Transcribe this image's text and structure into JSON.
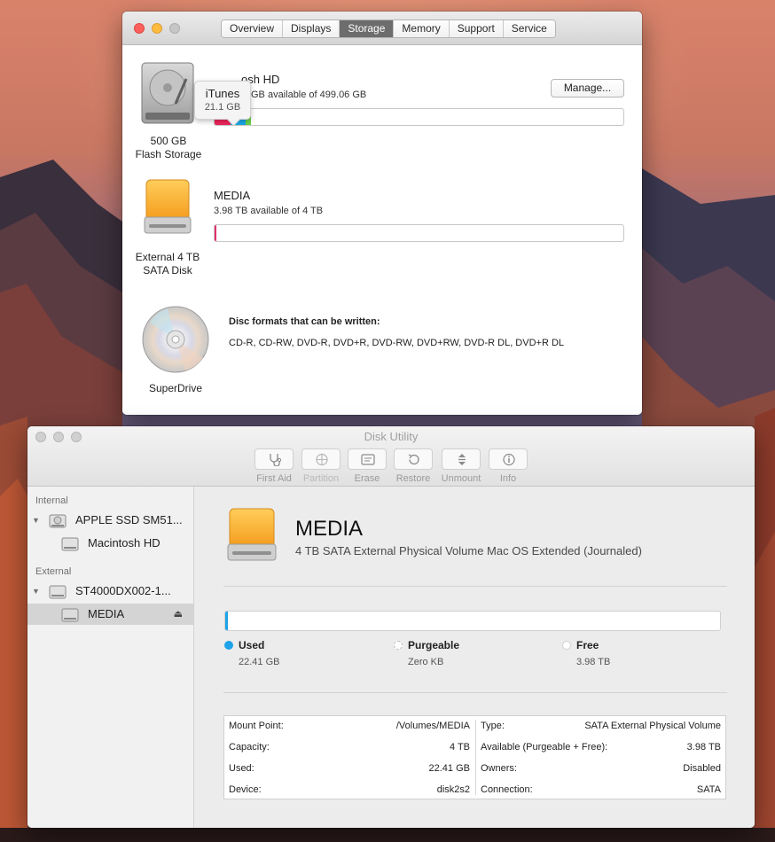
{
  "about": {
    "tabs": [
      "Overview",
      "Displays",
      "Storage",
      "Memory",
      "Support",
      "Service"
    ],
    "active_tab": "Storage",
    "tooltip": {
      "title": "iTunes",
      "value": "21.1 GB"
    },
    "disks": [
      {
        "name": "Macintosh HD",
        "name_visible": "osh HD",
        "available": "GB available of 499.06 GB",
        "caption_line1": "500 GB",
        "caption_line2": "Flash Storage",
        "manage_label": "Manage...",
        "bar_segments": [
          {
            "color": "#f0245c",
            "fraction": 0.04
          },
          {
            "color": "#1aa8e8",
            "fraction": 0.035
          },
          {
            "color": "#6ad04a",
            "fraction": 0.013
          }
        ]
      },
      {
        "name": "MEDIA",
        "available": "3.98 TB available of 4 TB",
        "caption_line1": "External 4 TB",
        "caption_line2": "SATA Disk",
        "bar_segments": [
          {
            "color": "#e0306a",
            "fraction": 0.005
          }
        ]
      }
    ],
    "superdrive": {
      "caption": "SuperDrive",
      "formats_title": "Disc formats that can be written:",
      "formats": "CD-R, CD-RW, DVD-R, DVD+R, DVD-RW, DVD+RW, DVD-R DL, DVD+R DL"
    }
  },
  "disk_utility": {
    "title": "Disk Utility",
    "toolbar": [
      "First Aid",
      "Partition",
      "Erase",
      "Restore",
      "Unmount",
      "Info"
    ],
    "sidebar": {
      "internal_header": "Internal",
      "external_header": "External",
      "items": [
        {
          "label": "APPLE SSD SM51..."
        },
        {
          "label": "Macintosh HD"
        },
        {
          "label": "ST4000DX002-1..."
        },
        {
          "label": "MEDIA"
        }
      ],
      "eject_icon": "eject-icon"
    },
    "volume": {
      "name": "MEDIA",
      "description": "4 TB SATA External Physical Volume Mac OS Extended (Journaled)",
      "used_fraction": 0.0056,
      "legend": [
        {
          "name": "Used",
          "value": "22.41 GB",
          "color": "#1ea2e8"
        },
        {
          "name": "Purgeable",
          "value": "Zero KB",
          "color": "#ffffff"
        },
        {
          "name": "Free",
          "value": "3.98 TB",
          "color": "#ffffff"
        }
      ]
    },
    "info_left": [
      {
        "key": "Mount Point:",
        "value": "/Volumes/MEDIA"
      },
      {
        "key": "Capacity:",
        "value": "4 TB"
      },
      {
        "key": "Used:",
        "value": "22.41 GB"
      },
      {
        "key": "Device:",
        "value": "disk2s2"
      }
    ],
    "info_right": [
      {
        "key": "Type:",
        "value": "SATA External Physical Volume"
      },
      {
        "key": "Available (Purgeable + Free):",
        "value": "3.98 TB"
      },
      {
        "key": "Owners:",
        "value": "Disabled"
      },
      {
        "key": "Connection:",
        "value": "SATA"
      }
    ]
  }
}
